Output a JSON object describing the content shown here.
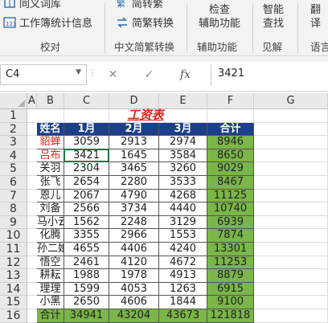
{
  "ribbon": {
    "items": {
      "simp_word": "简繁",
      "word_lib": "同义词库",
      "stats": "工作簿统计信息",
      "to_trad": "简转繁",
      "convert": "简繁转换",
      "check": "检查",
      "check2": "辅助功能",
      "smart": "智能",
      "smart2": "查找",
      "translate": "翻",
      "translate2": "译"
    },
    "groups": {
      "proofing": "校对",
      "chinese": "中文简繁转换",
      "accessibility": "辅助功能",
      "insights": "见解",
      "language": "语言"
    }
  },
  "formula_bar": {
    "name_box": "C4",
    "formula": "3421"
  },
  "grid": {
    "columns": [
      "A",
      "B",
      "C",
      "D",
      "E",
      "F",
      "G"
    ],
    "rows": [
      "1",
      "2",
      "3",
      "4",
      "5",
      "6",
      "7",
      "8",
      "9",
      "10",
      "11",
      "12",
      "13",
      "14",
      "15",
      "16"
    ],
    "title": "工资表",
    "headers": [
      "姓名",
      "1月",
      "2月",
      "3月",
      "合计"
    ],
    "table": [
      [
        "貂蝉",
        "3059",
        "2913",
        "2974",
        "8946"
      ],
      [
        "吕布",
        "3421",
        "1645",
        "3584",
        "8650"
      ],
      [
        "关羽",
        "2304",
        "3465",
        "3260",
        "9029"
      ],
      [
        "张飞",
        "2654",
        "2280",
        "3533",
        "8467"
      ],
      [
        "恩儿",
        "2067",
        "4790",
        "4268",
        "11125"
      ],
      [
        "刘备",
        "2566",
        "3734",
        "4440",
        "10740"
      ],
      [
        "马小云",
        "1562",
        "2248",
        "3129",
        "6939"
      ],
      [
        "化腾",
        "3355",
        "2966",
        "1553",
        "7874"
      ],
      [
        "孙二娘",
        "4655",
        "4406",
        "4240",
        "13301"
      ],
      [
        "悟空",
        "2461",
        "4120",
        "4672",
        "11253"
      ],
      [
        "耕耘",
        "1988",
        "1978",
        "4913",
        "8879"
      ],
      [
        "理理",
        "1599",
        "4053",
        "1263",
        "6915"
      ],
      [
        "小黑",
        "2650",
        "4606",
        "1844",
        "9100"
      ],
      [
        "合计",
        "34941",
        "43204",
        "43673",
        "121818"
      ]
    ]
  },
  "colors": {
    "header_bg": "#1d3e8c",
    "total_bg": "#7ab648",
    "title_red": "#d8251a"
  }
}
